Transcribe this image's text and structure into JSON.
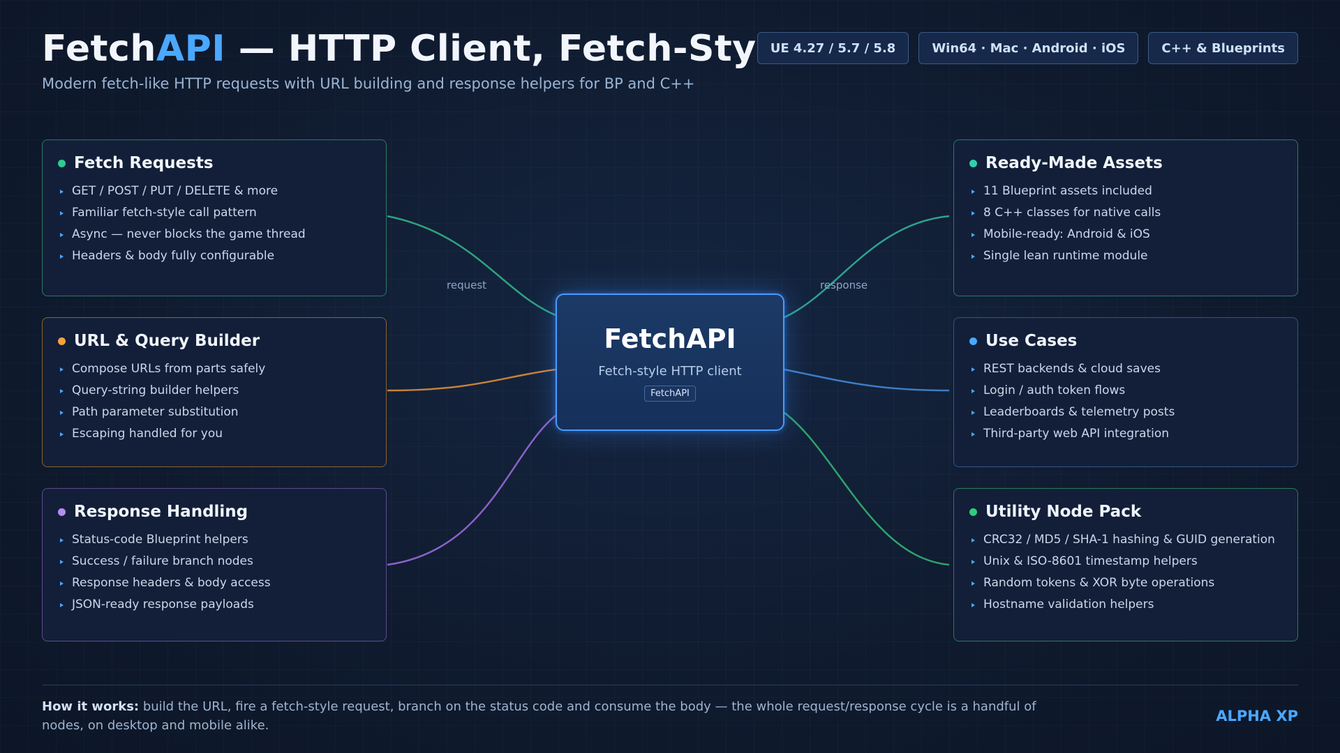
{
  "header": {
    "title_main": "Fetch",
    "title_accent": "API",
    "title_rest": " — HTTP Client, Fetch-Style",
    "subtitle": "Modern fetch-like HTTP requests with URL building and response helpers for BP and C++"
  },
  "badges": [
    "UE 4.27 / 5.7 / 5.8",
    "Win64 · Mac · Android · iOS",
    "C++ & Blueprints"
  ],
  "cards": {
    "fetch_requests": {
      "title": "Fetch Requests",
      "dot_color": "#2ecc8f",
      "border_color": "#2a7a66",
      "items": [
        "GET / POST / PUT / DELETE & more",
        "Familiar fetch-style call pattern",
        "Async — never blocks the game thread",
        "Headers & body fully configurable"
      ]
    },
    "url_builder": {
      "title": "URL & Query Builder",
      "dot_color": "#f5a23c",
      "border_color": "#8a6330",
      "items": [
        "Compose URLs from parts safely",
        "Query-string builder helpers",
        "Path parameter substitution",
        "Escaping handled for you"
      ]
    },
    "response_handling": {
      "title": "Response Handling",
      "dot_color": "#b48cf5",
      "border_color": "#5e4a90",
      "items": [
        "Status-code Blueprint helpers",
        "Success / failure branch nodes",
        "Response headers & body access",
        "JSON-ready response payloads"
      ]
    },
    "ready_made": {
      "title": "Ready-Made Assets",
      "dot_color": "#2fd1b0",
      "border_color": "#2a7a70",
      "items": [
        "11 Blueprint assets included",
        "8 C++ classes for native calls",
        "Mobile-ready: Android & iOS",
        "Single lean runtime module"
      ]
    },
    "use_cases": {
      "title": "Use Cases",
      "dot_color": "#4aa8ff",
      "border_color": "#2f5688",
      "items": [
        "REST backends & cloud saves",
        "Login / auth token flows",
        "Leaderboards & telemetry posts",
        "Third-party web API integration"
      ]
    },
    "utility_pack": {
      "title": "Utility Node Pack",
      "dot_color": "#2ecc7a",
      "border_color": "#2a7a5a",
      "items": [
        "CRC32 / MD5 / SHA-1 hashing & GUID generation",
        "Unix & ISO-8601 timestamp helpers",
        "Random tokens & XOR byte operations",
        "Hostname validation helpers"
      ]
    }
  },
  "connector_labels": {
    "left_top": "request",
    "right_top": "response"
  },
  "connector_colors": {
    "fetch_requests": "#2fa27e",
    "url_builder": "#c7813a",
    "response_handling": "#8a62c9",
    "ready_made": "#2fa28e",
    "use_cases": "#3d7dc4",
    "utility_pack": "#2fa26e"
  },
  "hub": {
    "title": "FetchAPI",
    "subtitle": "Fetch-style HTTP client",
    "chip": "FetchAPI"
  },
  "footer": {
    "lead": "How it works:",
    "text": " build the URL, fire a fetch-style request, branch on the status code and consume the body — the whole request/response cycle is a handful of nodes, on desktop and mobile alike."
  },
  "brand": "ALPHA XP"
}
